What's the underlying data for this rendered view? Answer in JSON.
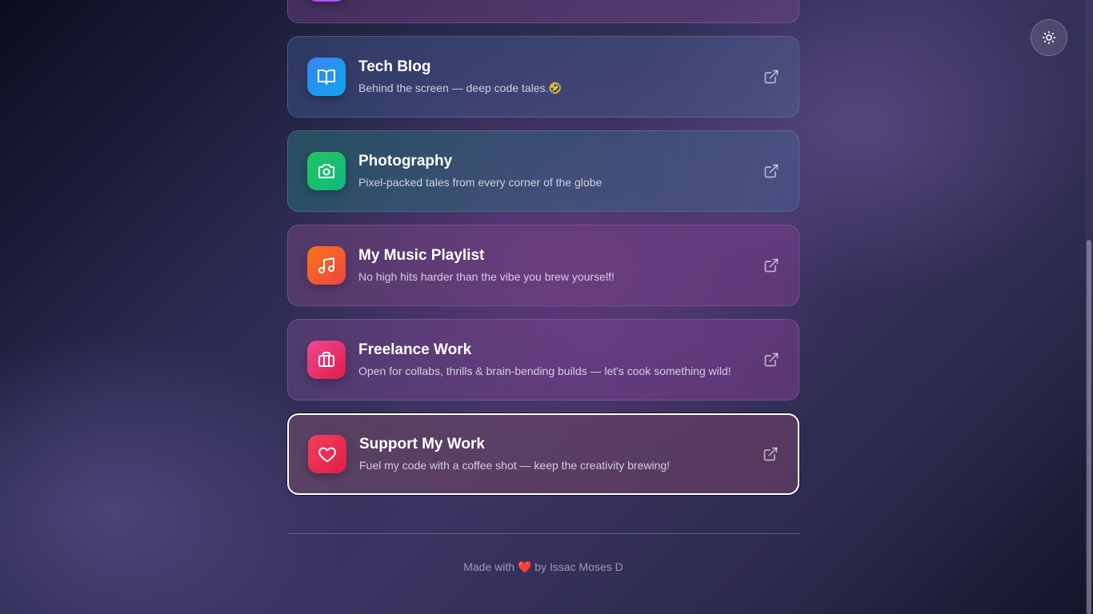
{
  "theme_toggle": {
    "icon": "sun-icon"
  },
  "links": [
    {
      "key": "top",
      "title": "",
      "description": "",
      "icon": "link-icon"
    },
    {
      "key": "blog",
      "title": "Tech Blog",
      "description": "Behind the screen — deep code tales.🤣",
      "icon": "book-open-icon"
    },
    {
      "key": "photo",
      "title": "Photography",
      "description": "Pixel-packed tales from every corner of the globe",
      "icon": "camera-icon"
    },
    {
      "key": "music",
      "title": "My Music Playlist",
      "description": "No high hits harder than the vibe you brew yourself!",
      "icon": "music-note-icon"
    },
    {
      "key": "freelance",
      "title": "Freelance Work",
      "description": "Open for collabs, thrills & brain-bending builds — let's cook something wild!",
      "icon": "briefcase-icon"
    },
    {
      "key": "support",
      "title": "Support My Work",
      "description": "Fuel my code with a coffee shot — keep the creativity brewing!",
      "icon": "heart-icon"
    }
  ],
  "footer": {
    "prefix": "Made with",
    "heart": "❤️",
    "suffix": "by Issac Moses D"
  },
  "colors": {
    "blog_icon": "#3b82f6",
    "photo_icon": "#22c55e",
    "music_icon": "#f97316",
    "freelance_icon": "#ec4899",
    "support_icon": "#f43f5e"
  }
}
